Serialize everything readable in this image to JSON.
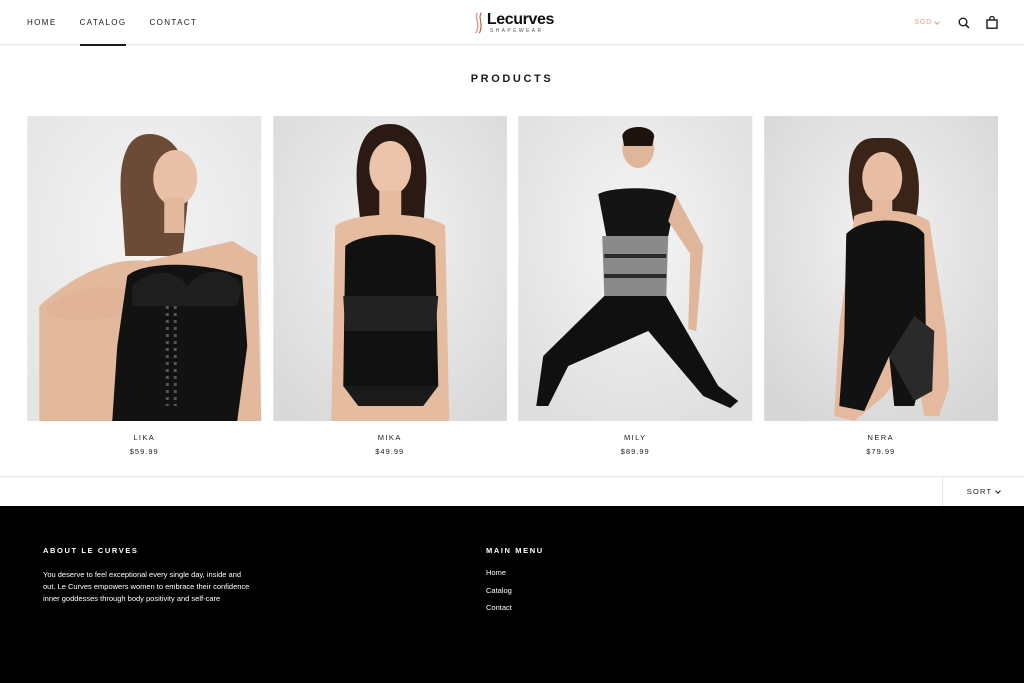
{
  "header": {
    "nav": [
      "Home",
      "Catalog",
      "Contact"
    ],
    "active_nav": "Catalog",
    "logo": {
      "word": "Lecurves",
      "sub": "SHAPEWEAR"
    },
    "currency": "SGD",
    "icons": [
      "search-icon",
      "cart-icon"
    ]
  },
  "main": {
    "title": "Products",
    "products": [
      {
        "name": "LIKA",
        "price": "$59.99"
      },
      {
        "name": "MIKA",
        "price": "$49.99"
      },
      {
        "name": "MILY",
        "price": "$89.99"
      },
      {
        "name": "NERA",
        "price": "$79.99"
      }
    ],
    "sort_label": "SORT"
  },
  "footer": {
    "about": {
      "title": "About Le Curves",
      "text": "You deserve to feel exceptional every single day, inside and out. Le Curves empowers women to embrace their confidence inner goddesses through body positivity and self-care"
    },
    "menu": {
      "title": "Main Menu",
      "links": [
        "Home",
        "Catalog",
        "Contact"
      ]
    }
  },
  "colors": {
    "accent": "#d9a088",
    "footer_bg": "#000000",
    "text": "#1c1b1b"
  }
}
